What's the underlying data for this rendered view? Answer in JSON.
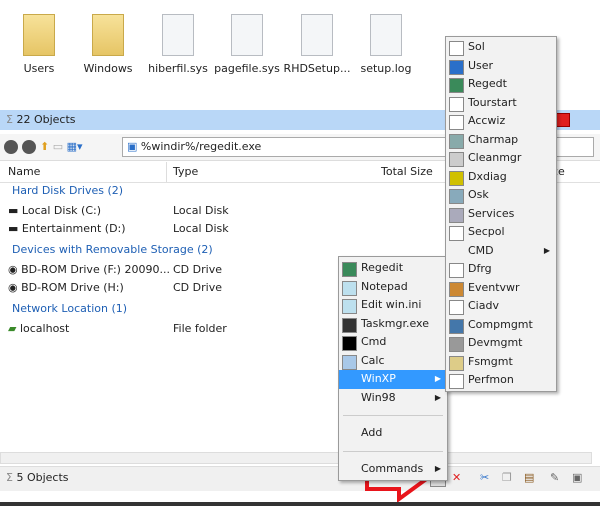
{
  "files": [
    "Users",
    "Windows",
    "hiberfil.sys",
    "pagefile.sys",
    "RHDSetup...",
    "setup.log"
  ],
  "top_status": "22 Objects",
  "address": "%windir%/regedit.exe",
  "columns": [
    "Name",
    "Type",
    "Total Size",
    "ce"
  ],
  "groups": [
    {
      "label": "Hard Disk Drives (2)",
      "items": [
        {
          "name": "Local Disk (C:)",
          "type": "Local Disk"
        },
        {
          "name": "Entertainment (D:)",
          "type": "Local Disk"
        }
      ]
    },
    {
      "label": "Devices with Removable Storage (2)",
      "items": [
        {
          "name": "BD-ROM Drive (F:) 20090...",
          "type": "CD Drive"
        },
        {
          "name": "BD-ROM Drive (H:)",
          "type": "CD Drive"
        }
      ]
    },
    {
      "label": "Network Location (1)",
      "items": [
        {
          "name": "localhost",
          "type": "File folder"
        }
      ]
    }
  ],
  "bottom_status": "5 Objects",
  "context_menu": [
    "Regedit",
    "Notepad",
    "Edit win.ini",
    "Taskmgr.exe",
    "Cmd",
    "Calc",
    "WinXP",
    "Win98",
    "Add",
    "Commands"
  ],
  "submenu": [
    "Sol",
    "User",
    "Regedt",
    "Tourstart",
    "Accwiz",
    "Charmap",
    "Cleanmgr",
    "Dxdiag",
    "Osk",
    "Services",
    "Secpol",
    "CMD",
    "Dfrg",
    "Eventvwr",
    "Ciadv",
    "Compmgmt",
    "Devmgmt",
    "Fsmgmt",
    "Perfmon"
  ],
  "colors": {
    "status_bar": "#b9d7f7",
    "highlight": "#3399ff",
    "group": "#1e5fb4",
    "arrow": "#e8141b"
  }
}
